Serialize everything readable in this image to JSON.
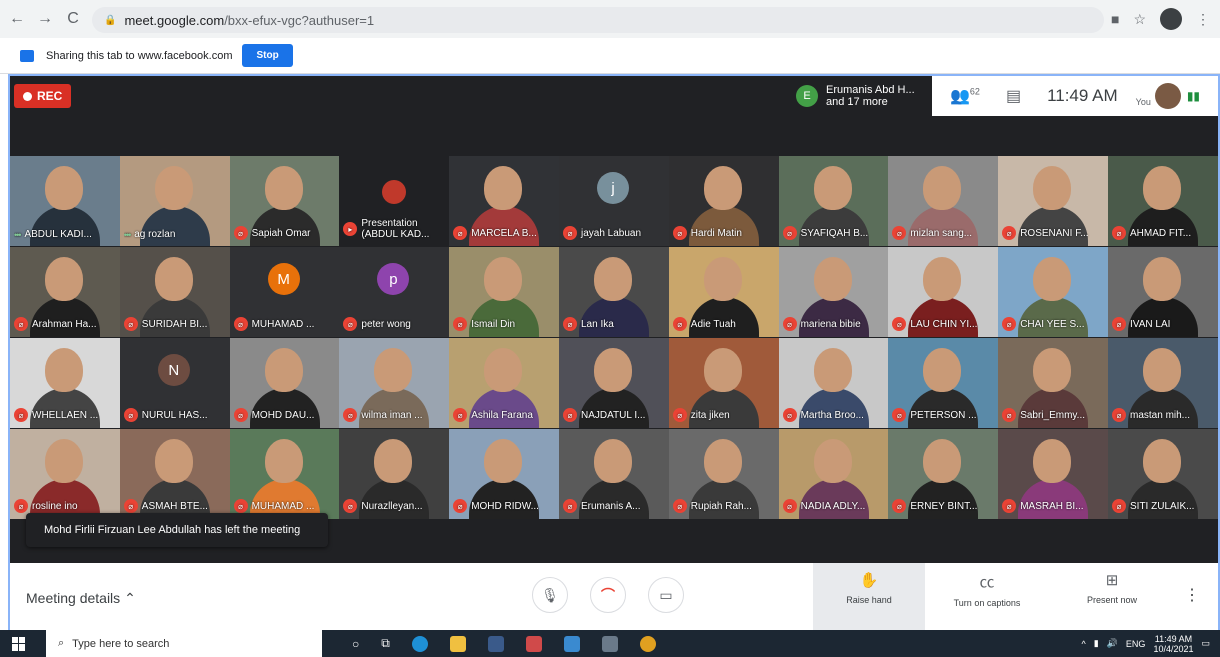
{
  "browser": {
    "url_host": "meet.google.com",
    "url_path": "/bxx-efux-vgc?authuser=1"
  },
  "share_bar": {
    "text": "Sharing this tab to www.facebook.com",
    "stop_label": "Stop"
  },
  "meet": {
    "rec_label": "REC",
    "joiners": {
      "initial": "E",
      "line1": "Erumanis Abd H...",
      "line2": "and 17 more"
    },
    "participants_count": "62",
    "clock": "11:49 AM",
    "you_label": "You"
  },
  "tiles": [
    {
      "name": "ABDUL KADI...",
      "state": "speaking",
      "bg": "#6a7d8c",
      "kind": "face",
      "shirt": "#26313c"
    },
    {
      "name": "ag rozlan",
      "state": "speaking",
      "bg": "#b49a80",
      "kind": "face",
      "shirt": "#2e3b4a"
    },
    {
      "name": "Sapiah Omar",
      "state": "muted",
      "bg": "#6d7b6a",
      "kind": "face",
      "shirt": "#2b2b2b"
    },
    {
      "name": "Presentation (ABDUL KAD...",
      "state": "present",
      "bg": "#202124",
      "kind": "present",
      "shirt": "#202124"
    },
    {
      "name": "MARCELA B...",
      "state": "muted",
      "bg": "#303236",
      "kind": "face",
      "shirt": "#a33a3a"
    },
    {
      "name": "jayah Labuan",
      "state": "muted",
      "bg": "#303134",
      "kind": "initial",
      "initial": "j",
      "color": "#78909c"
    },
    {
      "name": "Hardi Matin",
      "state": "muted",
      "bg": "#2f2f31",
      "kind": "face",
      "shirt": "#7c5a3c"
    },
    {
      "name": "SYAFIQAH B...",
      "state": "muted",
      "bg": "#5b6e5a",
      "kind": "face",
      "shirt": "#3c3c3c"
    },
    {
      "name": "mizlan sang...",
      "state": "muted",
      "bg": "#8a8a8a",
      "kind": "face",
      "shirt": "#9a6b6b"
    },
    {
      "name": "ROSENANI F...",
      "state": "muted",
      "bg": "#c8b8a8",
      "kind": "face",
      "shirt": "#444"
    },
    {
      "name": "AHMAD FIT...",
      "state": "muted",
      "bg": "#4a5a4a",
      "kind": "face",
      "shirt": "#1e1e1e"
    },
    {
      "name": "Arahman Ha...",
      "state": "muted",
      "bg": "#5e5a50",
      "kind": "face",
      "shirt": "#1f1f1f"
    },
    {
      "name": "SURIDAH BI...",
      "state": "muted",
      "bg": "#55504a",
      "kind": "face",
      "shirt": "#3a3a3a"
    },
    {
      "name": "MUHAMAD ...",
      "state": "muted",
      "bg": "#303134",
      "kind": "initial",
      "initial": "M",
      "color": "#e8710a"
    },
    {
      "name": "peter wong",
      "state": "muted",
      "bg": "#303134",
      "kind": "initial",
      "initial": "p",
      "color": "#8e44ad"
    },
    {
      "name": "Ismail Din",
      "state": "muted",
      "bg": "#9a8e6a",
      "kind": "face",
      "shirt": "#4a6a3a"
    },
    {
      "name": "Lan Ika",
      "state": "muted",
      "bg": "#4a4a4a",
      "kind": "face",
      "shirt": "#2a2a4a"
    },
    {
      "name": "Adie Tuah",
      "state": "muted",
      "bg": "#c9a66b",
      "kind": "face",
      "shirt": "#1f1f1f"
    },
    {
      "name": "mariena bibie",
      "state": "muted",
      "bg": "#a0a0a0",
      "kind": "face",
      "shirt": "#3c2a44"
    },
    {
      "name": "LAU CHIN YI...",
      "state": "muted",
      "bg": "#c8c8c8",
      "kind": "face",
      "shirt": "#7a1f1f"
    },
    {
      "name": "CHAI YEE S...",
      "state": "muted",
      "bg": "#7ea6c8",
      "kind": "face",
      "shirt": "#5a6a4a"
    },
    {
      "name": "IVAN LAI",
      "state": "muted",
      "bg": "#6a6a6a",
      "kind": "face",
      "shirt": "#1a1a1a"
    },
    {
      "name": "WHELLAEN ...",
      "state": "muted",
      "bg": "#d8d8d8",
      "kind": "face",
      "shirt": "#444"
    },
    {
      "name": "NURUL HAS...",
      "state": "muted",
      "bg": "#303134",
      "kind": "initial",
      "initial": "N",
      "color": "#6d4c41"
    },
    {
      "name": "MOHD DAU...",
      "state": "muted",
      "bg": "#8a8a8a",
      "kind": "face",
      "shirt": "#222"
    },
    {
      "name": "wilma iman ...",
      "state": "muted",
      "bg": "#9aa4b0",
      "kind": "face",
      "shirt": "#7a6a5a"
    },
    {
      "name": "Ashila Farana",
      "state": "muted",
      "bg": "#b8a070",
      "kind": "face",
      "shirt": "#6a4a8a"
    },
    {
      "name": "NAJDATUL I...",
      "state": "muted",
      "bg": "#505058",
      "kind": "face",
      "shirt": "#222"
    },
    {
      "name": "zita jiken",
      "state": "muted",
      "bg": "#a05a3a",
      "kind": "face",
      "shirt": "#3a3a3a"
    },
    {
      "name": "Martha Broo...",
      "state": "muted",
      "bg": "#c8c8c8",
      "kind": "face",
      "shirt": "#3a4a6a"
    },
    {
      "name": "PETERSON ...",
      "state": "muted",
      "bg": "#5a8aa8",
      "kind": "face",
      "shirt": "#2a2a2a"
    },
    {
      "name": "Sabri_Emmy...",
      "state": "muted",
      "bg": "#7a6a5a",
      "kind": "face",
      "shirt": "#5a3a3a"
    },
    {
      "name": "mastan mih...",
      "state": "muted",
      "bg": "#4a5a6a",
      "kind": "face",
      "shirt": "#2a2a2a"
    },
    {
      "name": "rosline ino",
      "state": "muted",
      "bg": "#c0b0a0",
      "kind": "face",
      "shirt": "#8a2a2a"
    },
    {
      "name": "ASMAH BTE...",
      "state": "muted",
      "bg": "#8a6a5a",
      "kind": "face",
      "shirt": "#3a3a3a"
    },
    {
      "name": "MUHAMAD ...",
      "state": "muted",
      "bg": "#5a7a5a",
      "kind": "face",
      "shirt": "#e07a30"
    },
    {
      "name": "Nurazlleyan...",
      "state": "muted",
      "bg": "#404040",
      "kind": "face",
      "shirt": "#2a2a2a"
    },
    {
      "name": "MOHD RIDW...",
      "state": "muted",
      "bg": "#8aa0b8",
      "kind": "face",
      "shirt": "#222"
    },
    {
      "name": "Erumanis A...",
      "state": "muted",
      "bg": "#5a5a5a",
      "kind": "face",
      "shirt": "#2a2a2a"
    },
    {
      "name": "Rupiah Rah...",
      "state": "muted",
      "bg": "#6a6a6a",
      "kind": "face",
      "shirt": "#3a3a3a"
    },
    {
      "name": "NADIA ADLY...",
      "state": "muted",
      "bg": "#b89a6a",
      "kind": "face",
      "shirt": "#6a3a5a"
    },
    {
      "name": "ERNEY BINT...",
      "state": "muted",
      "bg": "#6a7a6a",
      "kind": "face",
      "shirt": "#222"
    },
    {
      "name": "MASRAH BI...",
      "state": "muted",
      "bg": "#5a4a4a",
      "kind": "face",
      "shirt": "#8a3a7a"
    },
    {
      "name": "SITI ZULAIK...",
      "state": "muted",
      "bg": "#4a4a4a",
      "kind": "face",
      "shirt": "#2a2a2a"
    }
  ],
  "toast": "Mohd Firlii Firzuan Lee Abdullah has left the meeting",
  "bottom": {
    "meeting_details": "Meeting details",
    "raise_hand": "Raise hand",
    "captions": "Turn on captions",
    "present": "Present now"
  },
  "taskbar": {
    "search_placeholder": "Type here to search",
    "lang": "ENG",
    "time": "11:49 AM",
    "date": "10/4/2021"
  }
}
